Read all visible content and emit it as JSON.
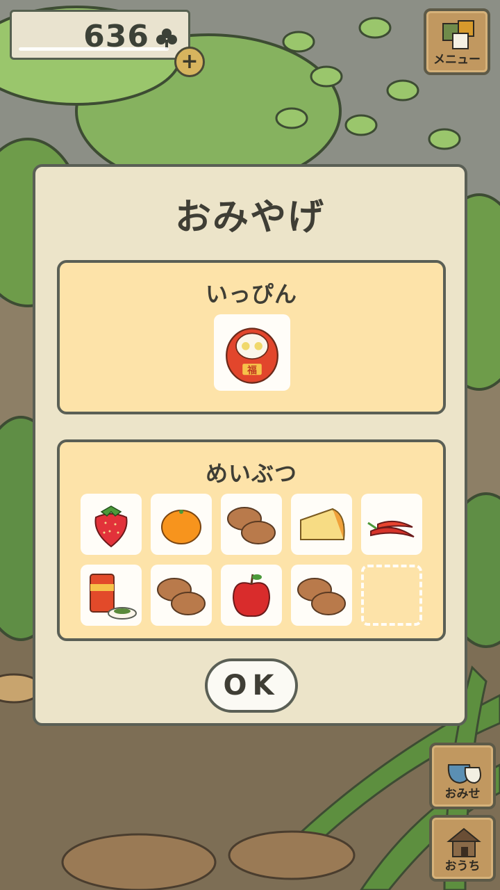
{
  "hud": {
    "clover_count": "636",
    "clover_icon": "clover-icon",
    "plus_label": "+",
    "menu_label": "メニュー",
    "shop_label": "おみせ",
    "home_label": "おうち"
  },
  "dialog": {
    "title": "おみやげ",
    "rare_section": {
      "title": "いっぴん",
      "items": [
        {
          "name": "daruma",
          "icon": "daruma-icon"
        }
      ]
    },
    "specialty_section": {
      "title": "めいぶつ",
      "items": [
        {
          "name": "strawberry",
          "icon": "strawberry-icon"
        },
        {
          "name": "mikan",
          "icon": "mikan-icon"
        },
        {
          "name": "manju",
          "icon": "manju-icon"
        },
        {
          "name": "cheese",
          "icon": "cheese-icon"
        },
        {
          "name": "chili-peppers",
          "icon": "chili-icon"
        },
        {
          "name": "tea-canister",
          "icon": "tea-icon"
        },
        {
          "name": "manju",
          "icon": "manju-icon"
        },
        {
          "name": "apple",
          "icon": "apple-icon"
        },
        {
          "name": "manju",
          "icon": "manju-icon"
        },
        {
          "name": "empty",
          "icon": "empty-slot"
        }
      ]
    },
    "ok_label": "OK"
  },
  "colors": {
    "dialog_bg": "#ece4c9",
    "panel_bg": "#fde3a9",
    "outline": "#5a5f55",
    "wood": "#c19860"
  }
}
